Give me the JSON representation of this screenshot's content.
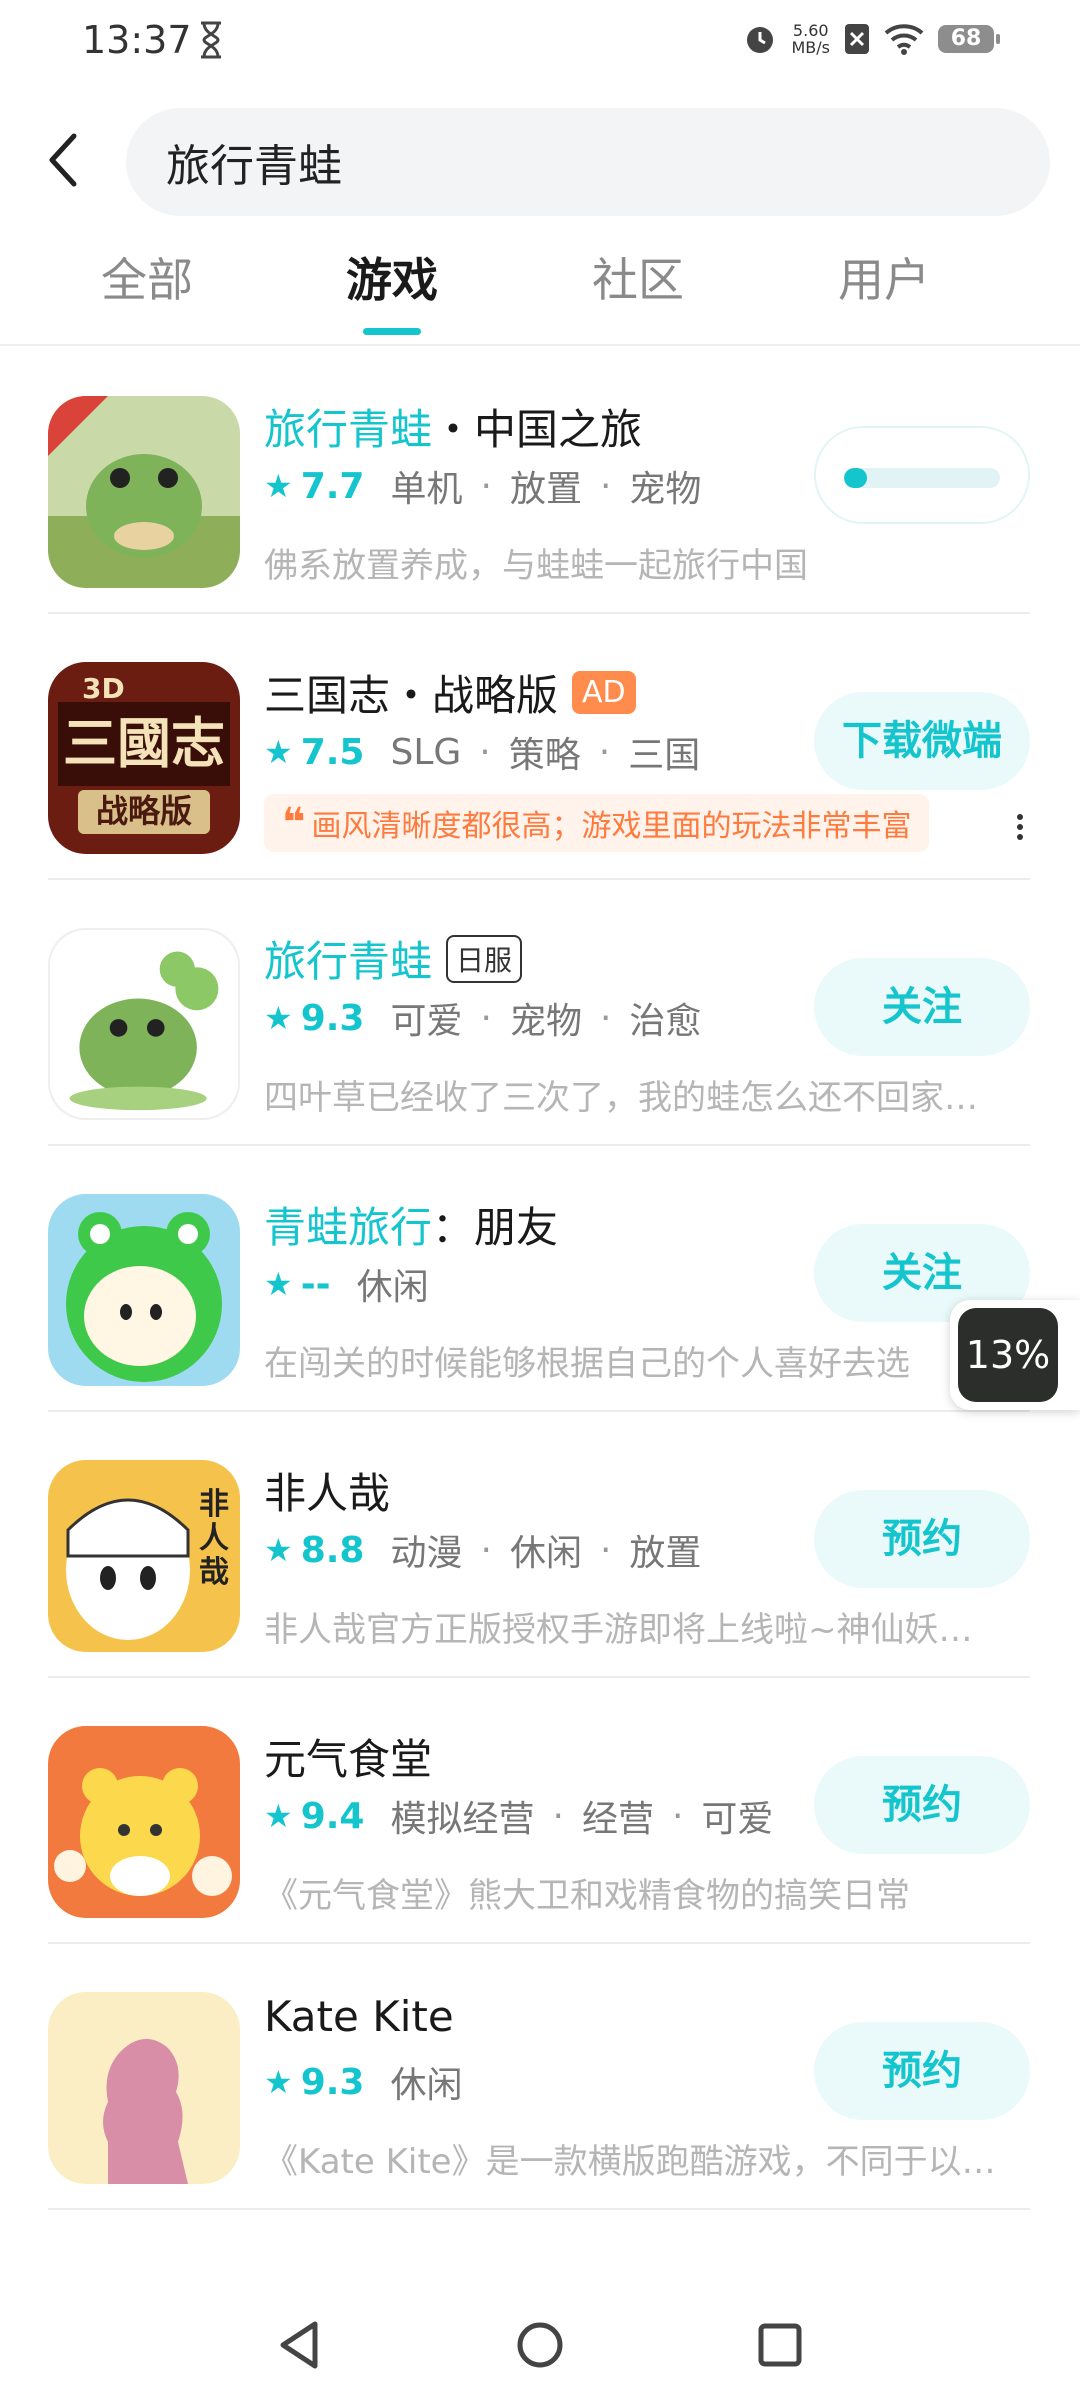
{
  "status_bar": {
    "time": "13:37",
    "net_speed_value": "5.60",
    "net_speed_unit": "MB/s",
    "battery": "68"
  },
  "search": {
    "query": "旅行青蛙"
  },
  "tabs": [
    {
      "label": "全部",
      "active": false
    },
    {
      "label": "游戏",
      "active": true
    },
    {
      "label": "社区",
      "active": false
    },
    {
      "label": "用户",
      "active": false
    }
  ],
  "results": [
    {
      "title_highlight": "旅行青蛙",
      "title_rest": "・中国之旅",
      "score": "7.7",
      "tags": [
        "单机",
        "放置",
        "宠物"
      ],
      "desc": "佛系放置养成，与蛙蛙一起旅行中国",
      "action": "",
      "download_progress": 0.15
    },
    {
      "title_highlight": "",
      "title_rest": "三国志・战略版",
      "badge": "AD",
      "score": "7.5",
      "tags": [
        "SLG",
        "策略",
        "三国"
      ],
      "review": "画风清晰度都很高；游戏里面的玩法非常丰富",
      "action": "下载微端"
    },
    {
      "title_highlight": "旅行青蛙",
      "title_rest": "",
      "badge": "日服",
      "score": "9.3",
      "tags": [
        "可爱",
        "宠物",
        "治愈"
      ],
      "desc": "四叶草已经收了三次了，我的蛙怎么还不回家…",
      "action": "关注"
    },
    {
      "title_highlight": "青蛙旅行",
      "title_rest": "：朋友",
      "score": "--",
      "tags": [
        "休闲"
      ],
      "desc": "在闯关的时候能够根据自己的个人喜好去选",
      "action": "关注"
    },
    {
      "title_highlight": "",
      "title_rest": "非人哉",
      "score": "8.8",
      "tags": [
        "动漫",
        "休闲",
        "放置"
      ],
      "desc": "非人哉官方正版授权手游即将上线啦~神仙妖…",
      "action": "预约"
    },
    {
      "title_highlight": "",
      "title_rest": "元气食堂",
      "score": "9.4",
      "tags": [
        "模拟经营",
        "经营",
        "可爱"
      ],
      "desc": "《元气食堂》熊大卫和戏精食物的搞笑日常",
      "action": "预约"
    },
    {
      "title_highlight": "",
      "title_rest": "Kate Kite",
      "score": "9.3",
      "tags": [
        "休闲"
      ],
      "desc": "《Kate Kite》是一款横版跑酷游戏，不同于以…",
      "action": "预约"
    }
  ],
  "floating_badge": {
    "text": "13%"
  },
  "icons": {
    "star": "★",
    "quote": "❝"
  },
  "colors": {
    "accent": "#15c5ce",
    "ad": "#ff8b4d",
    "review_text": "#ff7a3d"
  }
}
